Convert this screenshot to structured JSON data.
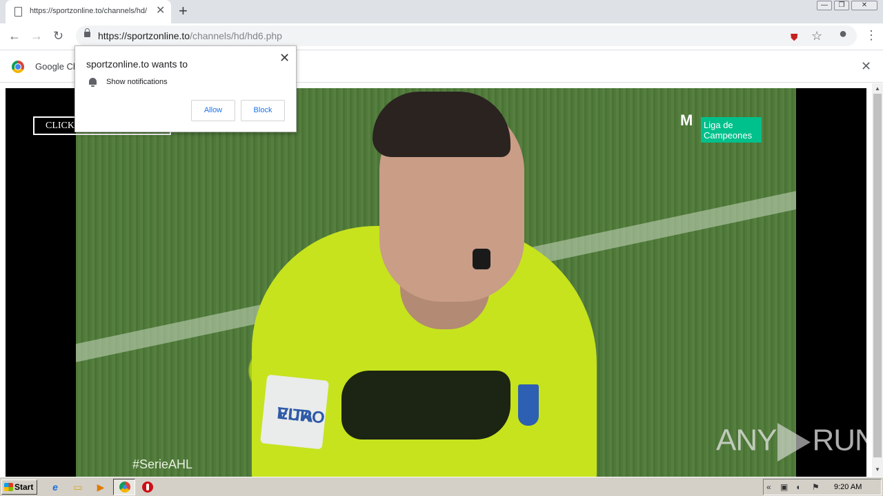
{
  "browser": {
    "tab": {
      "title": "https://sportzonline.to/channels/hd/",
      "close_glyph": "✕"
    },
    "new_tab_glyph": "+",
    "window_controls": {
      "minimize": "—",
      "restore": "❐",
      "close": "✕"
    },
    "toolbar": {
      "back_glyph": "←",
      "forward_glyph": "→",
      "reload_glyph": "↻",
      "url_host": "https://sportzonline.to",
      "url_path": "/channels/hd/hd6.php",
      "star_glyph": "☆",
      "account_glyph": "●",
      "menu_glyph": "⋮",
      "shield_glyph": "⛊"
    },
    "infobar": {
      "text": "Google Ch",
      "close_glyph": "✕"
    }
  },
  "popup": {
    "title": "sportzonline.to wants to",
    "permission": "Show notifications",
    "allow_label": "Allow",
    "block_label": "Block",
    "close_glyph": "✕"
  },
  "page": {
    "click_button_label": "CLICK",
    "video": {
      "hashtag": "#SerieAHL",
      "broadcaster_mark": "M",
      "competition_line1": "Liga de",
      "competition_line2": "Campeones",
      "sleeve_text_line1": "EURO",
      "sleeve_text_line2": "VITA",
      "watermark_left": "ANY",
      "watermark_right": "RUN"
    }
  },
  "scrollbar": {
    "up_glyph": "▲",
    "down_glyph": "▼"
  },
  "taskbar": {
    "start_label": "Start",
    "apps": {
      "ie": "e",
      "explorer": "▭",
      "media": "▶"
    },
    "tray": {
      "chevron": "«",
      "network": "▣",
      "volume": "◖",
      "flag": "⚑"
    },
    "clock": "9:20 AM"
  }
}
